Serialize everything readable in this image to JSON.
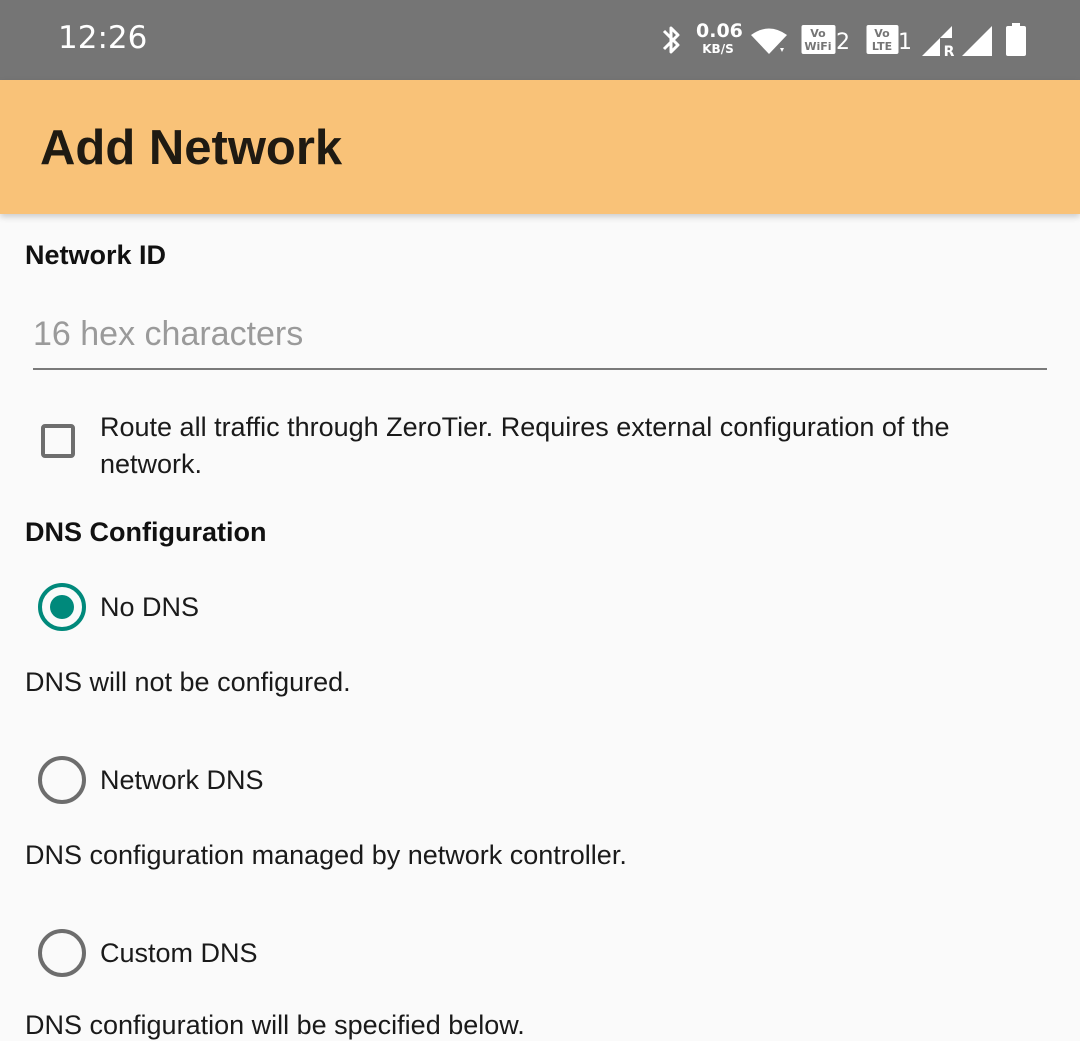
{
  "status_bar": {
    "time": "12:26",
    "net_speed_value": "0.06",
    "net_speed_unit": "KB/S",
    "icons": [
      "bluetooth-icon",
      "wifi-icon",
      "vowifi-icon",
      "volte-icon",
      "signal-roaming-icon",
      "signal-icon",
      "battery-icon"
    ],
    "vowifi_label": "Vo WiFi",
    "vowifi_slot": "2",
    "volte_label": "Vo LTE",
    "volte_slot": "1",
    "roaming_mark": "R"
  },
  "appbar": {
    "title": "Add Network",
    "color": "#f9c278"
  },
  "form": {
    "network_id_label": "Network ID",
    "network_id_value": "",
    "network_id_placeholder": "16 hex characters",
    "route_all_checked": false,
    "route_all_text": "Route all traffic through ZeroTier. Requires external configuration of the network.",
    "dns_section_label": "DNS Configuration",
    "dns_options": [
      {
        "label": "No DNS",
        "selected": true,
        "description": "DNS will not be configured."
      },
      {
        "label": "Network DNS",
        "selected": false,
        "description": "DNS configuration managed by network controller."
      },
      {
        "label": "Custom DNS",
        "selected": false,
        "description": "DNS configuration will be specified below."
      }
    ],
    "accent_color": "#00897b"
  }
}
